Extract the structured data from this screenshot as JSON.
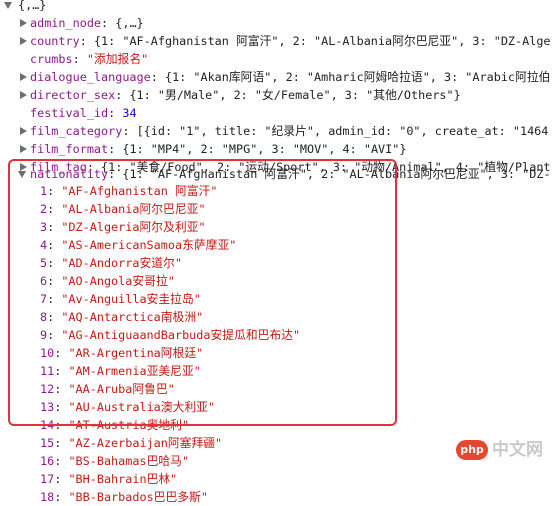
{
  "root": {
    "label": "{,…}"
  },
  "props": [
    {
      "key": "admin_node",
      "value": "{,…}",
      "type": "plain",
      "expandable": true
    },
    {
      "key": "country",
      "value": "{1: \"AF-Afghanistan 阿富汗\", 2: \"AL-Albania阿尔巴尼亚\", 3: \"DZ-Alge",
      "type": "plain",
      "expandable": true
    },
    {
      "key": "crumbs",
      "value": "\"添加报名\"",
      "type": "str",
      "expandable": false
    },
    {
      "key": "dialogue_language",
      "value": "{1: \"Akan库阿语\", 2: \"Amharic阿姆哈拉语\", 3: \"Arabic阿拉伯",
      "type": "plain",
      "expandable": true
    },
    {
      "key": "director_sex",
      "value": "{1: \"男/Male\", 2: \"女/Female\", 3: \"其他/Others\"}",
      "type": "plain",
      "expandable": true
    },
    {
      "key": "festival_id",
      "value": "34",
      "type": "num",
      "expandable": false
    },
    {
      "key": "film_category",
      "value": "[{id: \"1\", title: \"纪录片\", admin_id: \"0\", create_at: \"1464",
      "type": "plain",
      "expandable": true
    },
    {
      "key": "film_format",
      "value": "{1: \"MP4\", 2: \"MPG\", 3: \"MOV\", 4: \"AVI\"}",
      "type": "plain",
      "expandable": true
    },
    {
      "key": "film_tag",
      "value": "{1: \"美食/Food\", 2: \"运动/Sport\", 3: \"动物/Animal\", 4: \"植物/Plant",
      "type": "plain",
      "expandable": true
    },
    {
      "key": "nationality",
      "value": "{1: \"AF-Afghanistan 阿富汗\", 2: \"AL-Albania阿尔巴尼亚\", 3: \"DZ-",
      "type": "plain",
      "expandable": true,
      "expanded": true
    }
  ],
  "nationality_items": [
    {
      "key": "1",
      "value": "\"AF-Afghanistan 阿富汗\""
    },
    {
      "key": "2",
      "value": "\"AL-Albania阿尔巴尼亚\""
    },
    {
      "key": "3",
      "value": "\"DZ-Algeria阿尔及利亚\""
    },
    {
      "key": "4",
      "value": "\"AS-AmericanSamoa东萨摩亚\""
    },
    {
      "key": "5",
      "value": "\"AD-Andorra安道尔\""
    },
    {
      "key": "6",
      "value": "\"AO-Angola安哥拉\""
    },
    {
      "key": "7",
      "value": "\"Av-Anguilla安圭拉岛\""
    },
    {
      "key": "8",
      "value": "\"AQ-Antarctica南极洲\""
    },
    {
      "key": "9",
      "value": "\"AG-AntiguaandBarbuda安提瓜和巴布达\""
    },
    {
      "key": "10",
      "value": "\"AR-Argentina阿根廷\""
    },
    {
      "key": "11",
      "value": "\"AM-Armenia亚美尼亚\""
    },
    {
      "key": "12",
      "value": "\"AA-Aruba阿鲁巴\""
    },
    {
      "key": "13",
      "value": "\"AU-Australia澳大利亚\""
    },
    {
      "key": "14",
      "value": "\"AT-Austria奥地利\""
    },
    {
      "key": "15",
      "value": "\"AZ-Azerbaijan阿塞拜疆\""
    },
    {
      "key": "16",
      "value": "\"BS-Bahamas巴哈马\""
    },
    {
      "key": "17",
      "value": "\"BH-Bahrain巴林\""
    },
    {
      "key": "18",
      "value": "\"BB-Barbados巴巴多斯\""
    }
  ],
  "watermark": {
    "badge": "php",
    "text": "中文网"
  }
}
